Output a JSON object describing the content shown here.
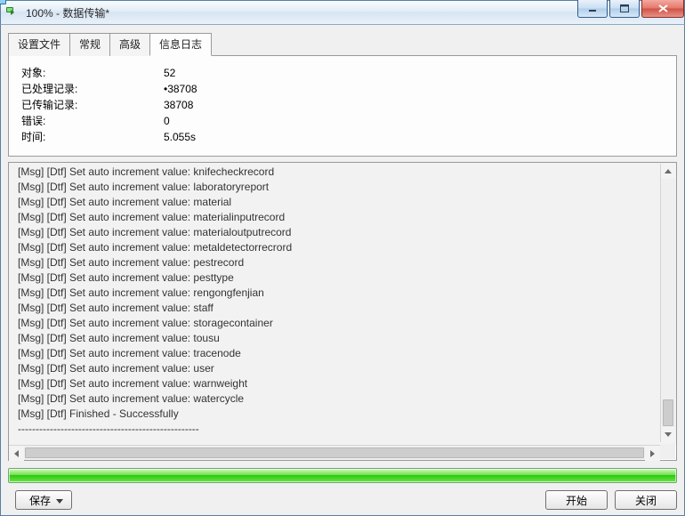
{
  "window": {
    "title": "100% - 数据传输*"
  },
  "tabs": [
    {
      "label": "设置文件"
    },
    {
      "label": "常规"
    },
    {
      "label": "高级"
    },
    {
      "label": "信息日志"
    }
  ],
  "active_tab_index": 3,
  "summary": {
    "rows": [
      {
        "label": "对象:",
        "value": "52"
      },
      {
        "label": "已处理记录:",
        "value": "•38708"
      },
      {
        "label": "已传输记录:",
        "value": "38708"
      },
      {
        "label": "错误:",
        "value": "0"
      },
      {
        "label": "时间:",
        "value": "5.055s"
      }
    ]
  },
  "log_lines": [
    "[Msg] [Dtf] Set auto increment value: knifecheckrecord",
    "[Msg] [Dtf] Set auto increment value: laboratoryreport",
    "[Msg] [Dtf] Set auto increment value: material",
    "[Msg] [Dtf] Set auto increment value: materialinputrecord",
    "[Msg] [Dtf] Set auto increment value: materialoutputrecord",
    "[Msg] [Dtf] Set auto increment value: metaldetectorrecrord",
    "[Msg] [Dtf] Set auto increment value: pestrecord",
    "[Msg] [Dtf] Set auto increment value: pesttype",
    "[Msg] [Dtf] Set auto increment value: rengongfenjian",
    "[Msg] [Dtf] Set auto increment value: staff",
    "[Msg] [Dtf] Set auto increment value: storagecontainer",
    "[Msg] [Dtf] Set auto increment value: tousu",
    "[Msg] [Dtf] Set auto increment value: tracenode",
    "[Msg] [Dtf] Set auto increment value: user",
    "[Msg] [Dtf] Set auto increment value: warnweight",
    "[Msg] [Dtf] Set auto increment value: watercycle",
    "[Msg] [Dtf] Finished - Successfully",
    "---------------------------------------------------"
  ],
  "buttons": {
    "save": "保存",
    "start": "开始",
    "close": "关闭"
  },
  "progress_percent": 100
}
